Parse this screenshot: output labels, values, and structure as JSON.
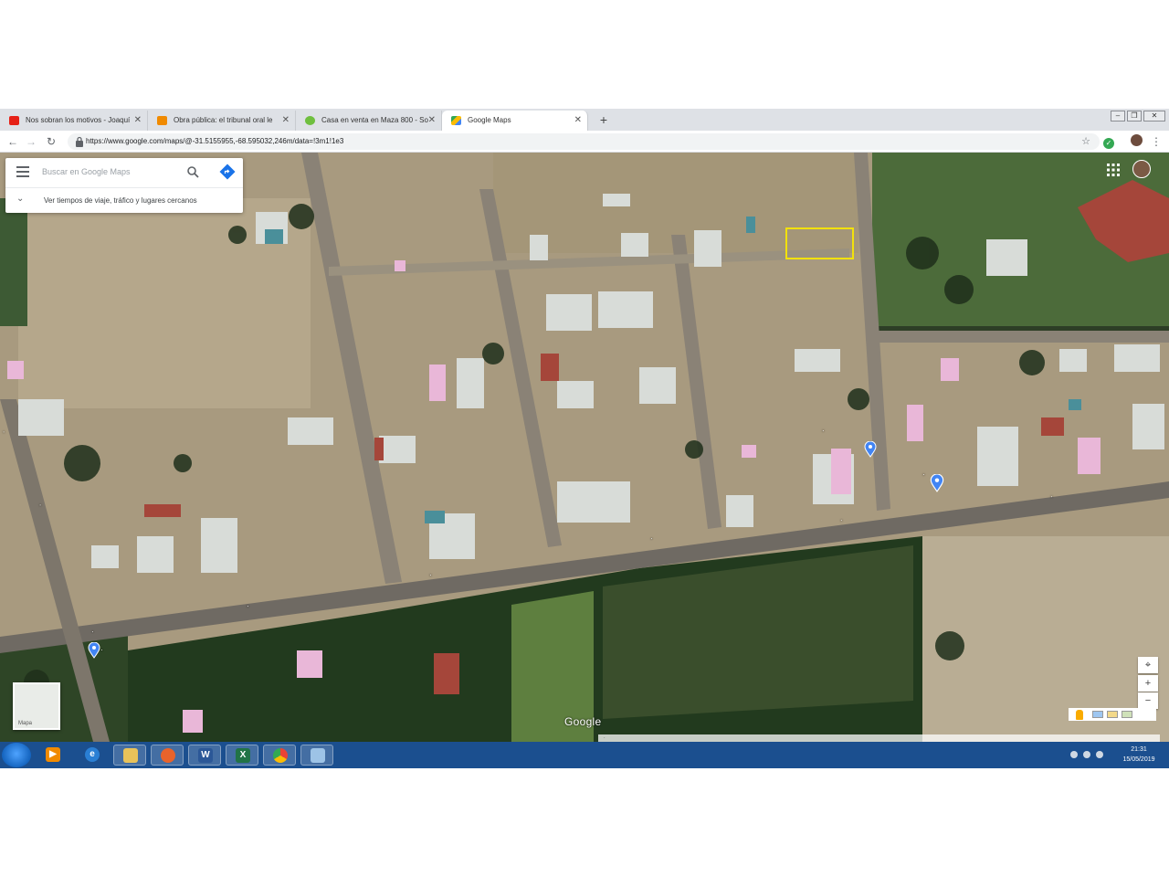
{
  "browser": {
    "tabs": [
      {
        "title": "Nos sobran los motivos - Joaquí",
        "favicon": "youtube-icon",
        "active": false
      },
      {
        "title": "Obra pública: el tribunal oral le",
        "favicon": "news-icon",
        "active": false
      },
      {
        "title": "Casa en venta en Maza 800 - So",
        "favicon": "listing-icon",
        "active": false
      },
      {
        "title": "Google Maps",
        "favicon": "maps-icon",
        "active": true
      }
    ],
    "new_tab_label": "+",
    "url": "https://www.google.com/maps/@-31.5155955,-68.595032,246m/data=!3m1!1e3"
  },
  "maps": {
    "search_placeholder": "Buscar en Google Maps",
    "nearby_label": "Ver tiempos de viaje, tráfico y lugares cercanos",
    "layers_label": "Mapa",
    "google_logo": "Google",
    "zoom_in_label": "+",
    "zoom_out_label": "−",
    "road_labels": [
      "·",
      "·",
      "·",
      "·",
      "·",
      "·",
      "·",
      "·"
    ],
    "place_labels": [
      "·",
      "·",
      "·"
    ],
    "attribution": "·"
  },
  "taskbar": {
    "time": "21:31",
    "date": "15/05/2019",
    "apps": [
      "windows-media-player-icon",
      "internet-explorer-icon",
      "file-explorer-icon",
      "firefox-icon",
      "word-icon",
      "excel-icon",
      "chrome-icon",
      "paint-icon"
    ]
  },
  "colors": {
    "selection": "#f2e10b",
    "taskbar": "#1b4f8f",
    "tab_strip": "#dee1e6"
  }
}
